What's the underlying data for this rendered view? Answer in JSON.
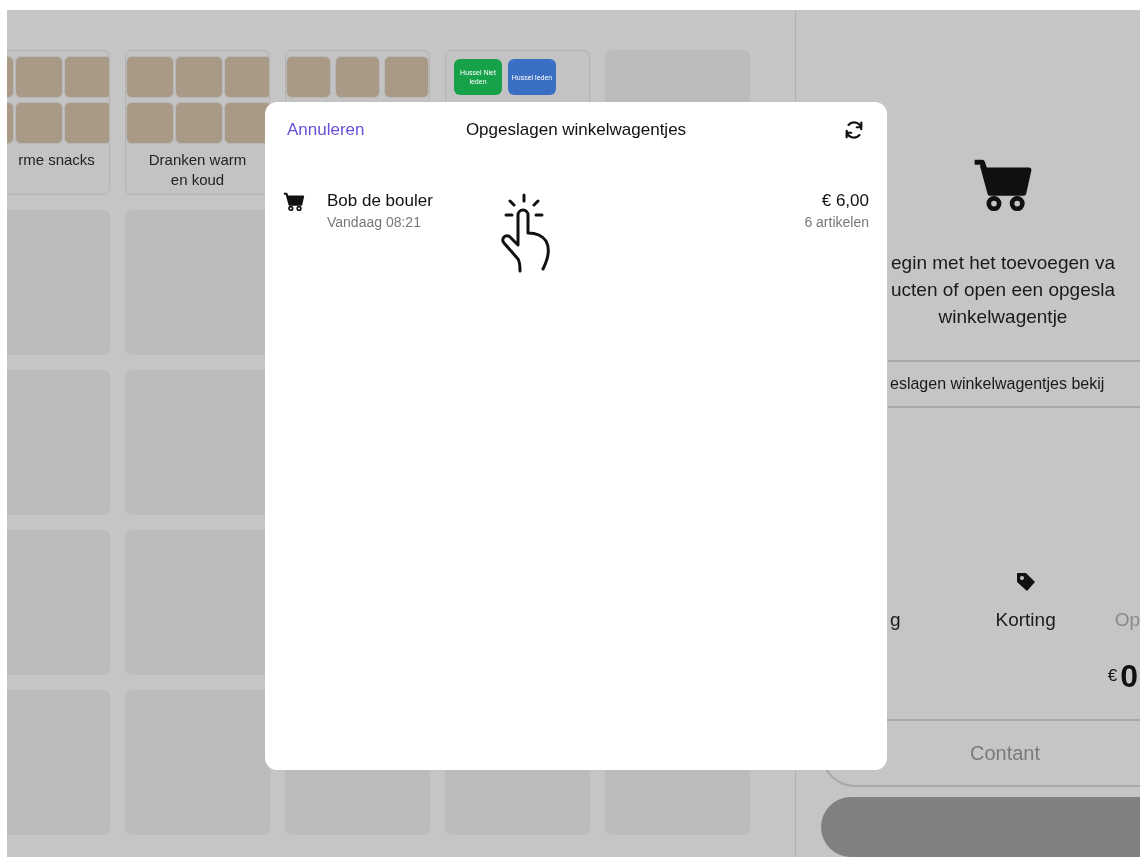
{
  "categories": [
    {
      "kind": "photo-grid",
      "label": "rme snacks"
    },
    {
      "kind": "photo-grid",
      "label": "Dranken warm en koud"
    },
    {
      "kind": "photo-row"
    },
    {
      "kind": "buttons",
      "buttons": [
        {
          "label": "Hussel Niet leden",
          "color": "#17a24a"
        },
        {
          "label": "Hussel leden",
          "color": "#3a6fc4"
        }
      ]
    },
    {
      "kind": "empty"
    }
  ],
  "cart_panel": {
    "empty_message": [
      "egin met het toevoegen va",
      "ucten of open een opgesla",
      "winkelwagentje"
    ],
    "saved_carts_button": "eslagen winkelwagentjes bekij",
    "actions": [
      {
        "label": "g",
        "disabled": false
      },
      {
        "label": "Korting",
        "disabled": false
      },
      {
        "label": "Op",
        "disabled": true
      }
    ],
    "currency": "€",
    "total": "0",
    "cash_button": "Contant"
  },
  "modal": {
    "cancel": "Annuleren",
    "title": "Opgeslagen winkelwagentjes",
    "carts": [
      {
        "name": "Bob de bouler",
        "time": "Vandaag 08:21",
        "amount": "€ 6,00",
        "items": "6 artikelen"
      }
    ]
  }
}
